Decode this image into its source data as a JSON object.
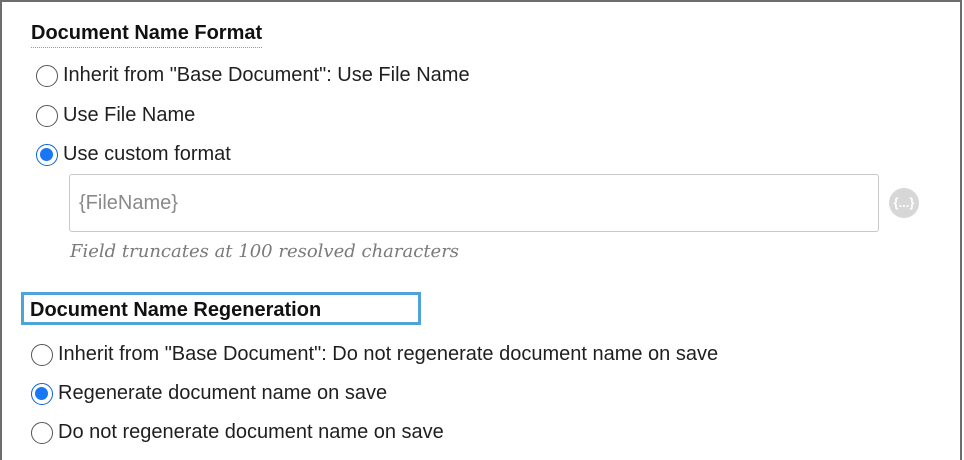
{
  "name_format": {
    "title": "Document Name Format",
    "options": [
      {
        "label": "Inherit from \"Base Document\": Use File Name",
        "selected": false
      },
      {
        "label": "Use File Name",
        "selected": false
      },
      {
        "label": "Use custom format",
        "selected": true
      }
    ],
    "custom_format_value": "{FileName}",
    "token_button_icon": "{...}",
    "hint": "Field truncates at 100 resolved characters"
  },
  "name_regeneration": {
    "title": "Document Name Regeneration",
    "options": [
      {
        "label": "Inherit from \"Base Document\": Do not regenerate document name on save",
        "selected": false
      },
      {
        "label": "Regenerate document name on save",
        "selected": true
      },
      {
        "label": "Do not regenerate document name on save",
        "selected": false
      }
    ]
  },
  "colors": {
    "radio_selected": "#1877f2",
    "focus_outline": "#4ea3d8"
  }
}
